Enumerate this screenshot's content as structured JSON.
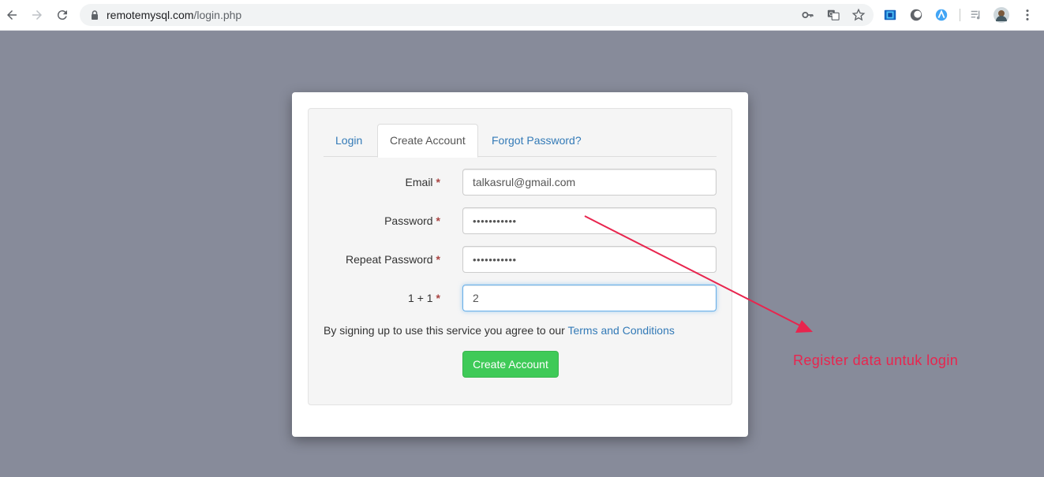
{
  "browser": {
    "url_host": "remotemysql.com",
    "url_path": "/login.php"
  },
  "tabs": [
    "Login",
    "Create Account",
    "Forgot Password?"
  ],
  "active_tab": "Create Account",
  "form": {
    "email_label": "Email",
    "email_value": "talkasrul@gmail.com",
    "password_label": "Password",
    "password_value": "•••••••••••",
    "repeat_password_label": "Repeat Password",
    "repeat_password_value": "•••••••••••",
    "captcha_label": "1 + 1",
    "captcha_value": "2",
    "required_mark": "*",
    "terms_text": "By signing up to use this service you agree to our",
    "terms_link": "Terms and Conditions",
    "submit_label": "Create Account"
  },
  "annotation": {
    "text": "Register data untuk login",
    "color": "#e8254e"
  },
  "colors": {
    "accent": "#337ab7",
    "button": "#3fca58",
    "backdrop": "#878b9a"
  },
  "icons": [
    "back-arrow-icon",
    "forward-arrow-icon",
    "reload-icon",
    "lock-icon",
    "key-icon",
    "translate-icon",
    "star-icon",
    "extension-icon",
    "moon-icon",
    "extension-icon",
    "media-icon",
    "avatar",
    "more-vert-icon"
  ]
}
